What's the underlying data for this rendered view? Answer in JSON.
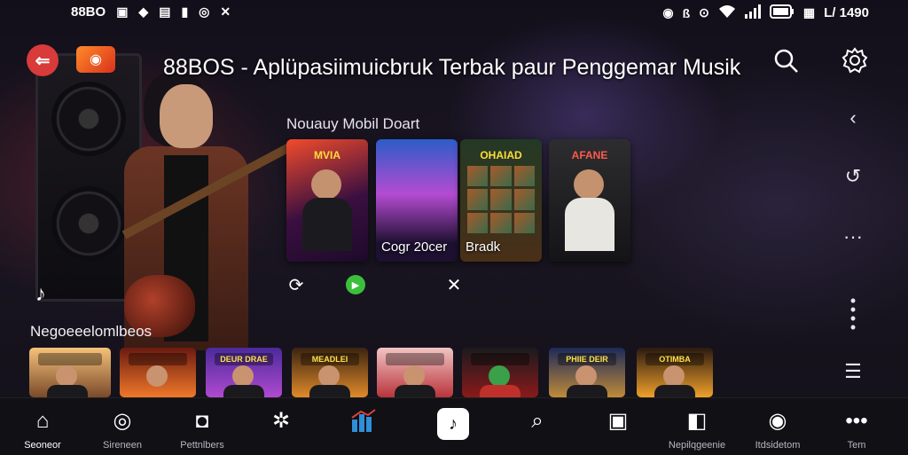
{
  "status_bar": {
    "left_text": "88BO",
    "left_icons": [
      "app-badge-icon",
      "shield-icon",
      "sim-icon",
      "notification-icon",
      "clock-icon",
      "close-icon"
    ],
    "right_icons": [
      "alarm-icon",
      "bluetooth-icon",
      "hotspot-icon",
      "wifi-icon",
      "signal-icon",
      "battery-icon",
      "sim-icon"
    ],
    "time": "L/ 1490"
  },
  "header": {
    "title": "88BOS - Aplüpasiimuicbruk Terbak paur Penggemar Musik"
  },
  "featured": {
    "title": "Nouauy Mobil Doart",
    "cards": [
      {
        "art_text": "MVIA",
        "label": ""
      },
      {
        "art_text": "",
        "label": "Cogr 20cer"
      },
      {
        "art_text": "OHAIAD",
        "label": "Bradk"
      },
      {
        "art_text": "AFANE",
        "label": ""
      }
    ]
  },
  "recommendations": {
    "title": "Negoeeelomlbeos",
    "items": [
      {
        "badge": ""
      },
      {
        "badge": ""
      },
      {
        "badge": "DEUR DRAE"
      },
      {
        "badge": "MEADLEI"
      },
      {
        "badge": ""
      },
      {
        "badge": ""
      },
      {
        "badge": "PHIIE DEIR"
      },
      {
        "badge": "OTIMBA"
      }
    ]
  },
  "bottom_nav": {
    "items": [
      {
        "label": "Seoneor",
        "icon": "home-icon"
      },
      {
        "label": "Sireneen",
        "icon": "target-icon"
      },
      {
        "label": "Pettnlbers",
        "icon": "camera-icon"
      },
      {
        "label": "",
        "icon": "gear-icon"
      },
      {
        "label": "",
        "icon": "chart-icon"
      },
      {
        "label": "",
        "icon": "music-note-icon"
      },
      {
        "label": "",
        "icon": "search-icon"
      },
      {
        "label": "",
        "icon": "card-icon"
      },
      {
        "label": "Nepilqgeenie",
        "icon": "media-icon"
      },
      {
        "label": "Itdsidetom",
        "icon": "record-icon"
      },
      {
        "label": "Tem",
        "icon": "more-icon"
      }
    ]
  },
  "colors": {
    "accent": "#d93a3a",
    "logo": "#ff8a2a",
    "nav_chart": "#2f8fd8",
    "green": "#3cbf3c"
  }
}
